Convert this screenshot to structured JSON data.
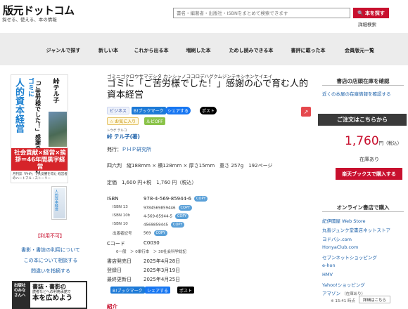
{
  "header": {
    "logo": "版元ドットコム",
    "tagline": "探せる、使える、本の情報",
    "search_placeholder": "書名・編著者・出版社・ISBNをまとめて検索できます",
    "search_button": "本を探す",
    "advanced": "詳細検索"
  },
  "nav": [
    "ジャンルで探す",
    "新しい本",
    "これから出る本",
    "増刷した本",
    "ためし読みできる本",
    "書評に載った本",
    "会員版元一覧"
  ],
  "book": {
    "kana": "ゴミニゴクロウサマデシタ カンシャノココロデハグクムジンテキシホンケイエイ",
    "title": "ゴミに「ご苦労様でした！」感謝の心で育む人的資本経営",
    "tags": {
      "biz": "ビジネス",
      "hatena": "B!ブックマーク",
      "facebook": "シェアする",
      "x": "ポスト",
      "fav": "☆ お気に入り",
      "ruby": "ルビOFF"
    },
    "author_ruby": "トウゲ テルコ",
    "author": "峠 テル子(著)",
    "publisher_label": "発行：",
    "publisher": "ＰＨＰ研究所",
    "size": "四六判　縦188mm × 横128mm × 厚さ15mm　重さ 257g　192ページ",
    "price": "定価　1,600 円+税　1,760 円（税込）",
    "isbn_label": "ISBN",
    "isbn": "978-4-569-85944-6",
    "copy": "COPY",
    "isbn13_label": "ISBN 13",
    "isbn13": "9784569859446",
    "isbn10h_label": "ISBN 10h",
    "isbn10h": "4-569-85944-5",
    "isbn10_label": "ISBN 10",
    "isbn10": "4569859445",
    "pubcode_label": "出版者記号",
    "pubcode": "569",
    "ccode_label": "Cコード",
    "ccode": "C0030",
    "ccode_sub": "0一般　＞ 0単行本　＞ 30社会科学総記",
    "dates": [
      {
        "label": "書店発売日",
        "value": "2025年4月28日"
      },
      {
        "label": "登録日",
        "value": "2025年3月19日"
      },
      {
        "label": "最終更新日",
        "value": "2025年4月25日"
      }
    ],
    "intro": "紹介"
  },
  "cover": {
    "big": "人的資本経営",
    "gomi": "ゴミに",
    "sub": "「ご苦労様でした！」感謝の心で育む",
    "author": "峠テル子",
    "band": "社会貢献×経営×挨拶＝46年間黒字経営",
    "band_sub": "月刊誌『PHP』で大反響を得た 経営者のハートフル・ストーリー"
  },
  "sidebar": {
    "usage": "【利用不可】",
    "links": [
      "書影・書誌の利用について",
      "この本について相談する",
      "問違いを指摘する"
    ],
    "banner_left": "出版社 のみなさんへ",
    "banner_r1": "書誌・書影の",
    "banner_r2": "読者などへの利用承諾で",
    "banner_r3": "本を広めよう"
  },
  "right": {
    "stock_title": "書店の店頭在庫を確認",
    "stock_link": "近くの本屋の在庫情報を確認する",
    "order_title": "ご注文はこちらから",
    "price": "1,760",
    "price_suffix": "円（税込）",
    "in_stock": "在庫あり",
    "rakuten": "楽天ブックスで購入する",
    "online_title": "オンライン書店で購入",
    "stores": [
      "紀伊國屋 Web Store",
      "丸善ジュンク堂書店ネットストア",
      "ヨドバシ.com",
      "HonyaClub.com",
      "セブンネットショッピング",
      "e-hon",
      "HMV",
      "Yahoo!ショッピング",
      "アマゾン"
    ],
    "amazon_note": "（在庫あり）",
    "amazon_time": "※ 15:41 時点",
    "detail": "詳細はこちら"
  }
}
